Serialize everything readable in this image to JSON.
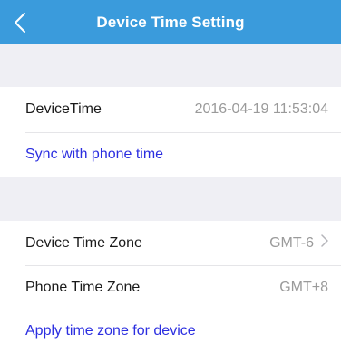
{
  "nav": {
    "title": "Device Time Setting",
    "back_icon": "chevron-left-icon"
  },
  "device_time_section": {
    "label": "DeviceTime",
    "value": "2016-04-19 11:53:04",
    "sync_link": "Sync with phone time"
  },
  "time_zone_section": {
    "device_zone_label": "Device Time Zone",
    "device_zone_value": "GMT-6",
    "device_zone_chevron": "chevron-right-icon",
    "phone_zone_label": "Phone Time Zone",
    "phone_zone_value": "GMT+8",
    "apply_link": "Apply time zone for device"
  },
  "colors": {
    "nav_background": "#3a9bdc",
    "link": "#2b2ee0",
    "page_background": "#efeff4"
  }
}
